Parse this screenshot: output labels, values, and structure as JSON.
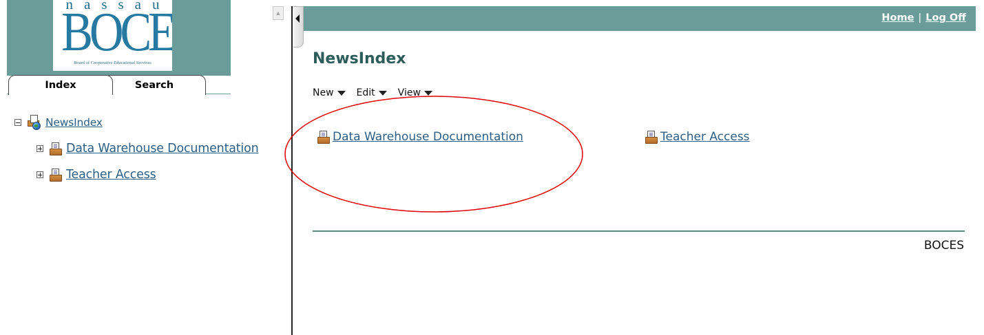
{
  "logo": {
    "top_text": "nassau",
    "main_text": "BOCES",
    "sub_text": "Board of Cooperative Educational Services"
  },
  "left_tabs": {
    "index": "Index",
    "search": "Search"
  },
  "tree": {
    "root": {
      "label": "NewsIndex",
      "expander": "minus"
    },
    "children": [
      {
        "label": "Data Warehouse Documentation",
        "expander": "plus"
      },
      {
        "label": "Teacher Access",
        "expander": "plus"
      }
    ]
  },
  "topbar": {
    "home": "Home",
    "separator": "|",
    "logoff": "Log Off"
  },
  "page": {
    "title": "NewsIndex",
    "menu": [
      "New",
      "Edit",
      "View"
    ],
    "items": [
      "Data Warehouse Documentation",
      "Teacher Access"
    ],
    "footer": "BOCES"
  },
  "colors": {
    "banner": "#6a9c99",
    "link": "#2c5e86",
    "title": "#2d5d5a",
    "annotation": "#e00000"
  },
  "icons": [
    "minus-box-icon",
    "plus-box-icon",
    "globe-folder-icon",
    "document-folder-icon",
    "triangle-down-icon",
    "collapse-arrow-icon",
    "scroll-up-icon"
  ]
}
